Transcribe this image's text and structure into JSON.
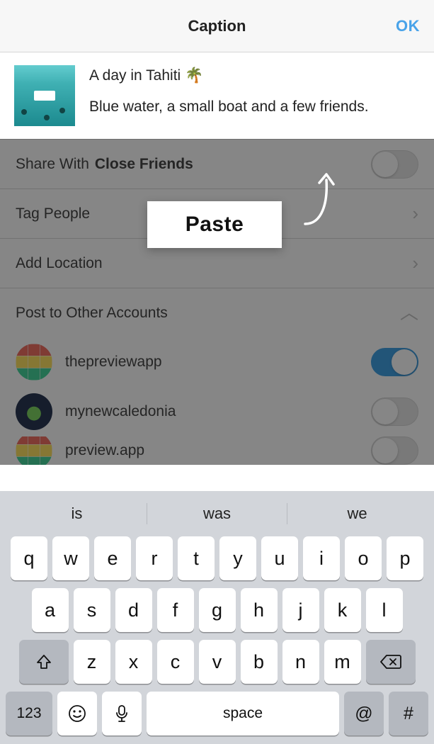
{
  "header": {
    "title": "Caption",
    "ok_label": "OK"
  },
  "caption": {
    "line1": "A day in Tahiti 🌴",
    "line2": "Blue water, a small boat and a few friends."
  },
  "rows": {
    "share_label_prefix": "Share With ",
    "share_label_bold": "Close Friends",
    "tag_label": "Tag People",
    "location_label": "Add Location",
    "post_other_label": "Post to Other Accounts"
  },
  "accounts": [
    {
      "name": "thepreviewapp",
      "on": true,
      "avatar": "grid"
    },
    {
      "name": "mynewcaledonia",
      "on": false,
      "avatar": "cal"
    },
    {
      "name": "preview.app",
      "on": false,
      "avatar": "grid"
    }
  ],
  "paste_label": "Paste",
  "keyboard": {
    "suggestions": [
      "is",
      "was",
      "we"
    ],
    "row1": [
      "q",
      "w",
      "e",
      "r",
      "t",
      "y",
      "u",
      "i",
      "o",
      "p"
    ],
    "row2": [
      "a",
      "s",
      "d",
      "f",
      "g",
      "h",
      "j",
      "k",
      "l"
    ],
    "row3": [
      "z",
      "x",
      "c",
      "v",
      "b",
      "n",
      "m"
    ],
    "numbers_label": "123",
    "space_label": "space",
    "at_label": "@",
    "hash_label": "#"
  }
}
